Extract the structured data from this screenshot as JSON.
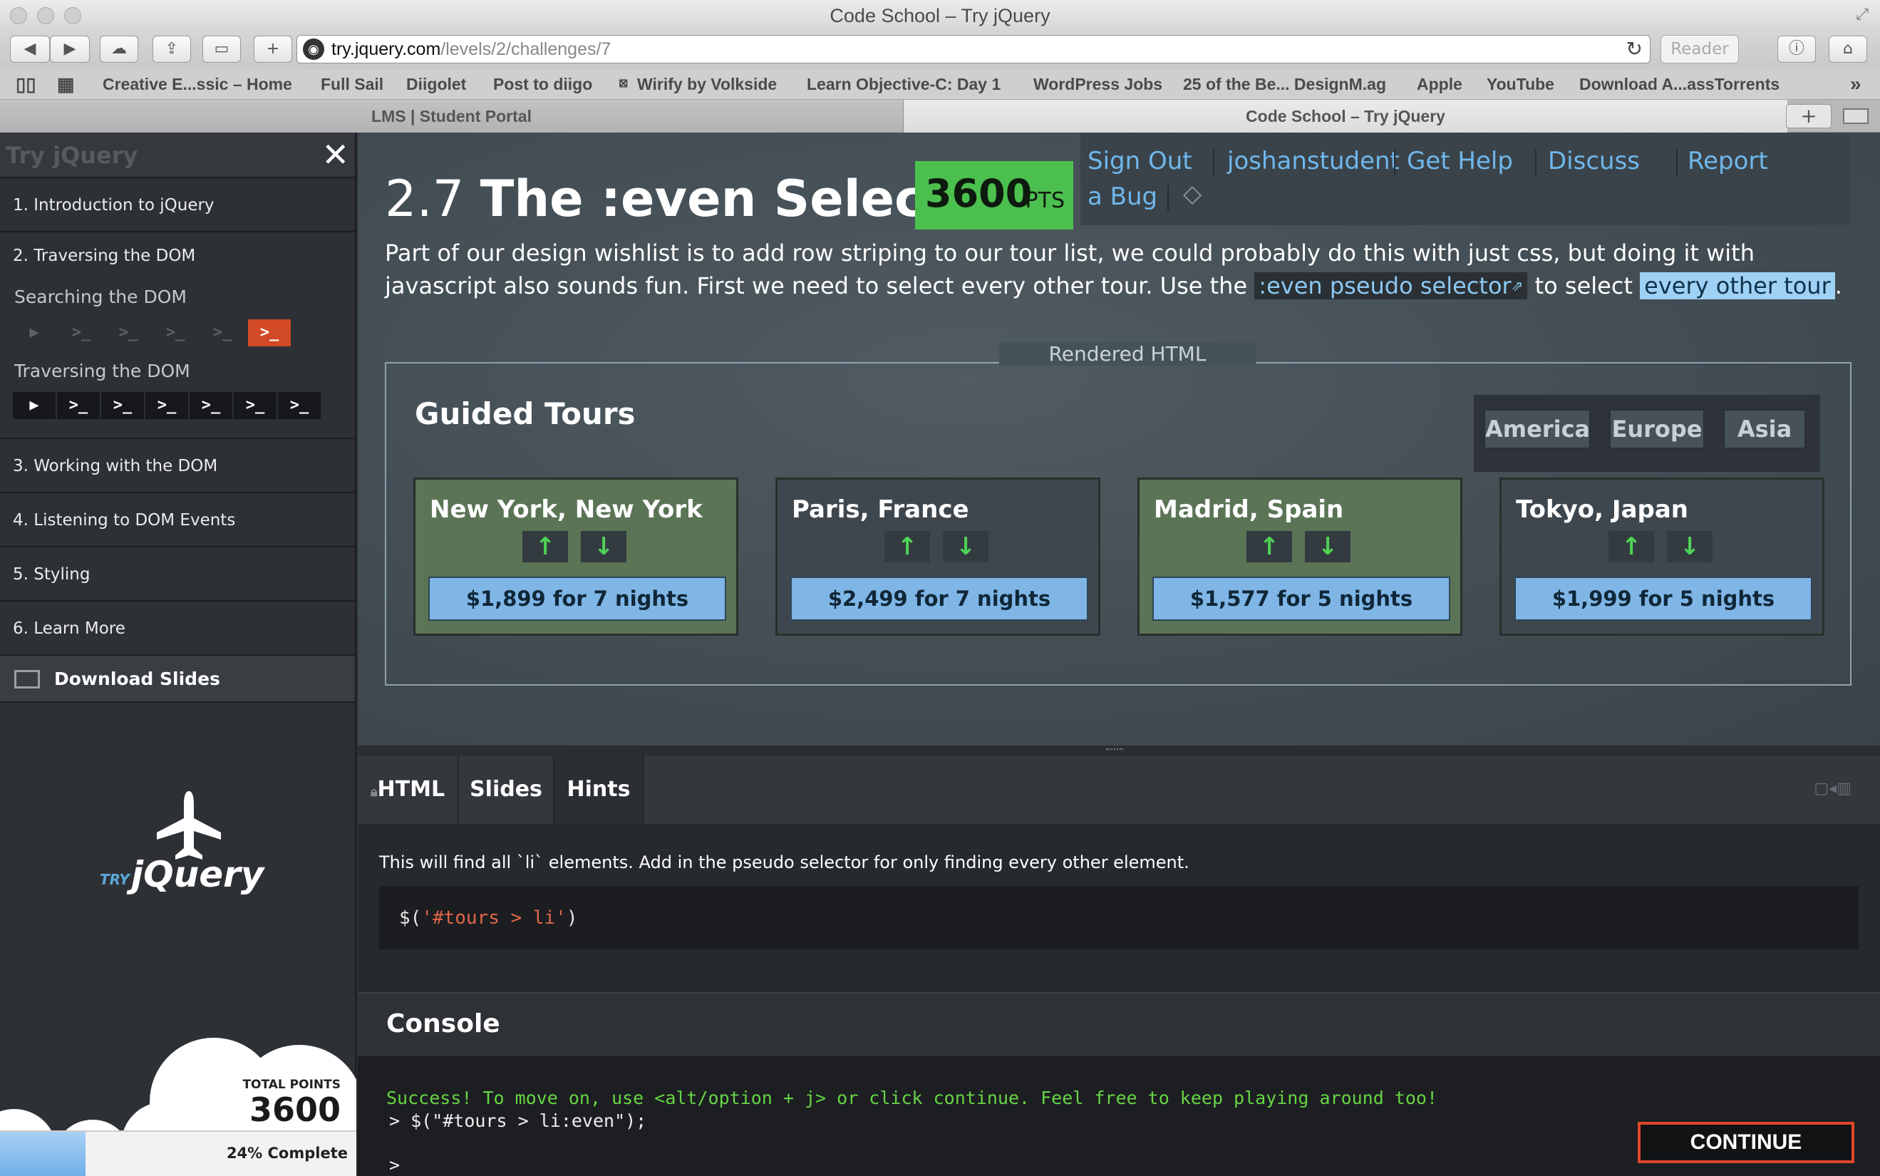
{
  "window": {
    "title": "Code School – Try jQuery"
  },
  "toolbar": {
    "url_host": "try.jquery.com",
    "url_path": "/levels/2/challenges/7",
    "reader_label": "Reader"
  },
  "bookmarks": [
    "Creative E...ssic – Home",
    "Full Sail",
    "Diigolet",
    "Post to diigo",
    "Wirify by Volkside",
    "Learn Objective-C: Day 1",
    "WordPress Jobs",
    "25 of the Be... DesignM.ag",
    "Apple",
    "YouTube",
    "Download A...assTorrents"
  ],
  "tabs": [
    {
      "label": "LMS | Student Portal"
    },
    {
      "label": "Code School – Try jQuery"
    }
  ],
  "sidebar": {
    "brand": "Try jQuery",
    "levels": [
      "1. Introduction to jQuery",
      "2. Traversing the DOM",
      "3. Working with the DOM",
      "4. Listening to DOM Events",
      "5. Styling",
      "6. Learn More"
    ],
    "sections": [
      "Searching the DOM",
      "Traversing the DOM"
    ],
    "download_slides": "Download Slides",
    "logo_try": "TRY",
    "logo_jquery": "jQuery",
    "total_points_label": "TOTAL POINTS",
    "total_points": "3600",
    "progress_text": "24% Complete",
    "progress_percent": 24
  },
  "challenge": {
    "number": "2.7",
    "name": "The :even Selector",
    "points": "3600",
    "points_unit": "PTS",
    "links": [
      "Sign Out",
      "joshanstudent",
      "Get Help",
      "Discuss",
      "Report",
      "a Bug"
    ],
    "desc_before": "Part of our design wishlist is to add row striping to our tour list, we could probably do this with just css, but doing it with javascript also sounds fun. First we need to select every other tour. Use the ",
    "desc_link": ":even pseudo selector",
    "desc_mid": " to select ",
    "desc_highlight": "every other tour",
    "desc_after": "."
  },
  "rendered": {
    "label": "Rendered HTML",
    "heading": "Guided Tours",
    "filters": [
      "America",
      "Europe",
      "Asia"
    ],
    "tours": [
      {
        "city": "New York, New York",
        "price": "$1,899 for 7 nights"
      },
      {
        "city": "Paris, France",
        "price": "$2,499 for 7 nights"
      },
      {
        "city": "Madrid, Spain",
        "price": "$1,577 for 5 nights"
      },
      {
        "city": "Tokyo, Japan",
        "price": "$1,999 for 5 nights"
      }
    ]
  },
  "editor": {
    "tabs": [
      "HTML",
      "Slides",
      "Hints"
    ],
    "hint": "This will find all `li` elements. Add in the pseudo selector for only finding every other element.",
    "code_prefix": "$(",
    "code_string": "'#tours > li'",
    "code_suffix": ")"
  },
  "console": {
    "title": "Console",
    "success": "Success! To move on, use <alt/option + j> or click continue. Feel free to keep playing around too!",
    "command": "> $(\"#tours > li:even\");",
    "prompt": ">",
    "continue_label": "CONTINUE"
  },
  "colors": {
    "accent_green": "#4cc04f",
    "link_blue": "#6fb7ec",
    "current_challenge": "#d24a26",
    "success_text": "#67d445"
  }
}
